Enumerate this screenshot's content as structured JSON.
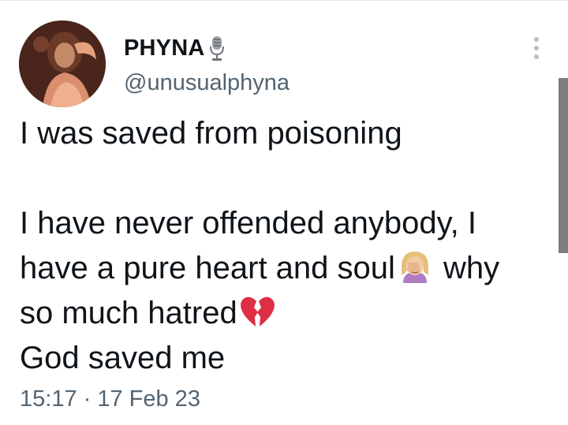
{
  "user": {
    "display_name": "PHYNA",
    "handle": "@unusualphyna"
  },
  "icons": {
    "avatar": "profile-photo",
    "name_badge": "microphone-icon",
    "more": "more-vertical-icon",
    "emoji_1": "facepalm-emoji",
    "emoji_2": "broken-heart-emoji"
  },
  "tweet": {
    "line1": "I was saved from poisoning",
    "line2": "I have never offended anybody, I",
    "line3_a": "have a pure heart and soul",
    "line3_b": " why",
    "line4": "so much hatred",
    "line5": "God saved me"
  },
  "timestamp": "15:17 · 17 Feb 23",
  "colors": {
    "text": "#0f1419",
    "secondary_text": "#536471",
    "scrollbar": "#7e7e7e"
  }
}
